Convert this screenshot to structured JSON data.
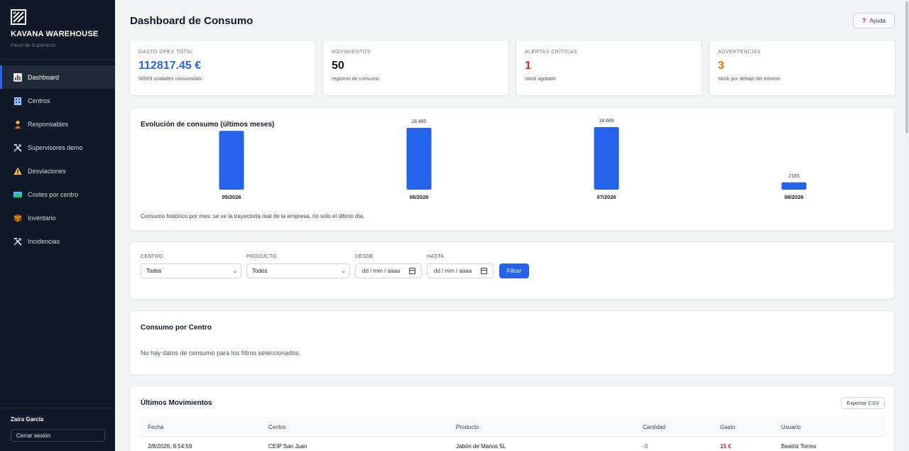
{
  "sidebar": {
    "brand_title": "KAVANA WAREHOUSE",
    "brand_subtitle": "Panel de Supervisor",
    "items": [
      {
        "label": "Dashboard",
        "icon": "bar-chart-icon"
      },
      {
        "label": "Centros",
        "icon": "building-icon"
      },
      {
        "label": "Responsables",
        "icon": "person-icon"
      },
      {
        "label": "Supervisores demo",
        "icon": "tools-icon"
      },
      {
        "label": "Desviaciones",
        "icon": "warning-icon"
      },
      {
        "label": "Costes por centro",
        "icon": "map-icon"
      },
      {
        "label": "Inventario",
        "icon": "package-icon"
      },
      {
        "label": "Incidencias",
        "icon": "tools-icon"
      }
    ],
    "user_name": "Zaira García",
    "logout_label": "Cerrar sesión"
  },
  "header": {
    "title": "Dashboard de Consumo",
    "help_label": "Ayuda"
  },
  "stats": [
    {
      "label": "GASTO OPEX TOTAL",
      "value": "112817.45 €",
      "sub": "56909 unidades consumidas",
      "color": "#2563eb"
    },
    {
      "label": "MOVIMIENTOS",
      "value": "50",
      "sub": "registros de consumo",
      "color": "#111827"
    },
    {
      "label": "ALERTAS CRÍTICAS",
      "value": "1",
      "sub": "stock agotado",
      "color": "#dc2626"
    },
    {
      "label": "ADVERTENCIAS",
      "value": "3",
      "sub": "stock por debajo del mínimo",
      "color": "#d97706"
    }
  ],
  "chart": {
    "title": "Evolución de consumo (últimos meses)",
    "note": "Consumo histórico por mes: se ve la trayectoria real de la empresa, no solo el último día."
  },
  "chart_data": {
    "type": "bar",
    "categories": [
      "05/2026",
      "06/2026",
      "07/2026",
      "08/2026"
    ],
    "values": [
      17570,
      18485,
      18689,
      2165
    ],
    "value_labels": [
      "",
      "18.485",
      "18.689",
      "2165"
    ],
    "bar_color": "#2563eb",
    "ylim": [
      0,
      18689
    ]
  },
  "filters": {
    "centro_label": "CENTRO",
    "centro_value": "Todos",
    "producto_label": "PRODUCTO",
    "producto_value": "Todos",
    "desde_label": "DESDE",
    "desde_placeholder": "dd / mm / aaaa",
    "hasta_label": "HASTA",
    "hasta_placeholder": "dd / mm / aaaa",
    "button_label": "Filtrar"
  },
  "consumo_centro": {
    "title": "Consumo por Centro",
    "empty_message": "No hay datos de consumo para los filtros seleccionados."
  },
  "movimientos": {
    "title": "Últimos Movimientos",
    "export_label": "Exportar CSV",
    "columns": [
      "Fecha",
      "Centro",
      "Producto",
      "Cantidad",
      "Gasto",
      "Usuario"
    ],
    "rows": [
      [
        "2/8/2026, 8:54:59",
        "CEIP San Juan",
        "Jabón de Manos 5L",
        "-3",
        "15 €",
        "Beatriz Torres"
      ]
    ]
  }
}
